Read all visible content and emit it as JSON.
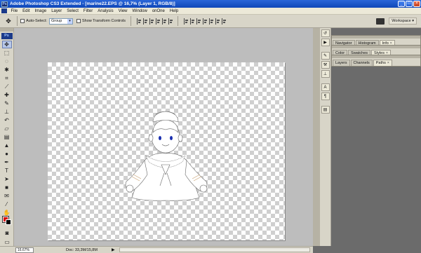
{
  "window": {
    "title": "Adobe Photoshop CS3 Extended - [marine22.EPS @ 16,7% (Layer 1, RGB/8)]",
    "app_icon": "Ps",
    "buttons": [
      "_",
      "□",
      "×"
    ]
  },
  "menu": [
    "File",
    "Edit",
    "Image",
    "Layer",
    "Select",
    "Filter",
    "Analysis",
    "View",
    "Window",
    "onOne",
    "Help"
  ],
  "options": {
    "auto_select_label": "Auto-Select:",
    "auto_select_value": "Group",
    "show_transform_label": "Show Transform Controls",
    "workspace_label": "Workspace ▾"
  },
  "toolbox": {
    "logo": "Ps",
    "tools": [
      "move-tool",
      "marquee-tool",
      "lasso-tool",
      "magic-wand-tool",
      "crop-tool",
      "slice-tool",
      "healing-brush-tool",
      "brush-tool",
      "clone-stamp-tool",
      "history-brush-tool",
      "eraser-tool",
      "gradient-tool",
      "blur-tool",
      "dodge-tool",
      "pen-tool",
      "type-tool",
      "path-selection-tool",
      "shape-tool",
      "notes-tool",
      "eyedropper-tool",
      "hand-tool",
      "zoom-tool"
    ],
    "foreground_color": "#d40000",
    "background_color": "#000000"
  },
  "status": {
    "zoom": "16.67%",
    "doc_info": "Doc: 33,3M/15,8M",
    "arrow": "▶"
  },
  "panels": [
    {
      "tabs": [
        "Navigator",
        "Histogram",
        "Info"
      ],
      "active": "Info"
    },
    {
      "tabs": [
        "Color",
        "Swatches",
        "Styles"
      ],
      "active": "Styles"
    },
    {
      "tabs": [
        "Layers",
        "Channels",
        "Paths"
      ],
      "active": "Paths"
    }
  ],
  "colors": {
    "title_bar": "#1a56c8",
    "chrome": "#d8d5c8",
    "canvas_bg": "#bdbdbd",
    "panel_bg": "#6b6b6b"
  }
}
